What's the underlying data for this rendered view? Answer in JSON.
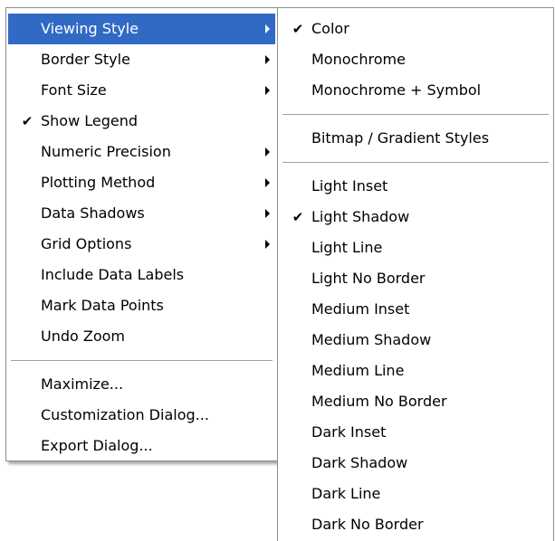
{
  "main_menu": {
    "items": [
      {
        "label": "Viewing Style",
        "check": "",
        "submenu": true,
        "highlighted": true
      },
      {
        "label": "Border Style",
        "check": "",
        "submenu": true,
        "highlighted": false
      },
      {
        "label": "Font Size",
        "check": "",
        "submenu": true,
        "highlighted": false
      },
      {
        "label": "Show Legend",
        "check": "✔",
        "submenu": false,
        "highlighted": false
      },
      {
        "label": "Numeric Precision",
        "check": "",
        "submenu": true,
        "highlighted": false
      },
      {
        "label": "Plotting Method",
        "check": "",
        "submenu": true,
        "highlighted": false
      },
      {
        "label": "Data Shadows",
        "check": "",
        "submenu": true,
        "highlighted": false
      },
      {
        "label": "Grid Options",
        "check": "",
        "submenu": true,
        "highlighted": false
      },
      {
        "label": "Include Data Labels",
        "check": "",
        "submenu": false,
        "highlighted": false
      },
      {
        "label": "Mark Data Points",
        "check": "",
        "submenu": false,
        "highlighted": false
      },
      {
        "label": "Undo Zoom",
        "check": "",
        "submenu": false,
        "highlighted": false
      }
    ],
    "items_after_separator": [
      {
        "label": "Maximize...",
        "check": ""
      },
      {
        "label": "Customization Dialog...",
        "check": ""
      },
      {
        "label": "Export Dialog...",
        "check": ""
      }
    ]
  },
  "submenu": {
    "group1": [
      {
        "label": "Color",
        "check": "✔"
      },
      {
        "label": "Monochrome",
        "check": ""
      },
      {
        "label": "Monochrome + Symbol",
        "check": ""
      }
    ],
    "group2": [
      {
        "label": "Bitmap / Gradient Styles",
        "check": ""
      }
    ],
    "group3": [
      {
        "label": "Light Inset",
        "check": ""
      },
      {
        "label": "Light Shadow",
        "check": "✔"
      },
      {
        "label": "Light Line",
        "check": ""
      },
      {
        "label": "Light No Border",
        "check": ""
      },
      {
        "label": "Medium Inset",
        "check": ""
      },
      {
        "label": "Medium Shadow",
        "check": ""
      },
      {
        "label": "Medium Line",
        "check": ""
      },
      {
        "label": "Medium No Border",
        "check": ""
      },
      {
        "label": "Dark Inset",
        "check": ""
      },
      {
        "label": "Dark Shadow",
        "check": ""
      },
      {
        "label": "Dark Line",
        "check": ""
      },
      {
        "label": "Dark No Border",
        "check": ""
      }
    ]
  },
  "colors": {
    "highlight": "#316ac5",
    "highlight_text": "#ffffff",
    "separator": "#a0a0a0",
    "border": "#8d8d8d"
  },
  "icons": {
    "check": "check-icon",
    "submenu_arrow": "submenu-arrow-icon"
  }
}
